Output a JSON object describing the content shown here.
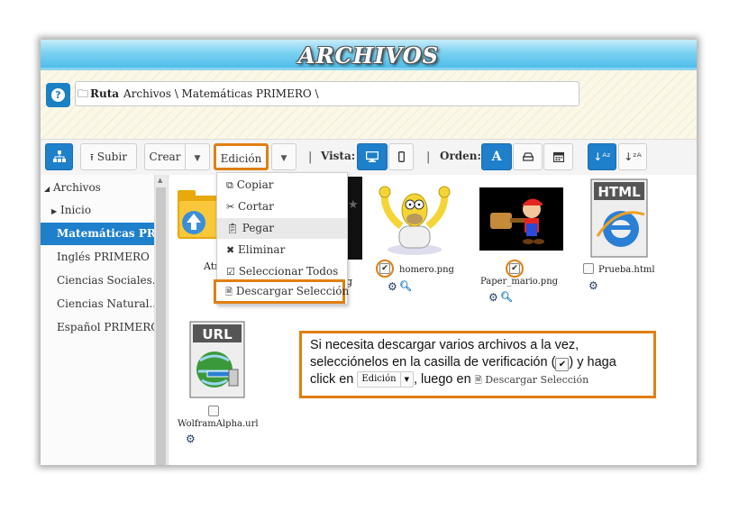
{
  "header": {
    "title": "ARCHIVOS"
  },
  "path_bar": {
    "route_label": "Ruta",
    "path_value": "Archivos \\ Matemáticas PRIMERO \\"
  },
  "toolbar": {
    "upload_label": "Subir",
    "create_label": "Crear",
    "edit_label": "Edición",
    "view_label": "Vista:",
    "order_label": "Orden:",
    "sort_a_label": "A",
    "separator": "|"
  },
  "sidebar": {
    "root": "Archivos",
    "items": [
      "Inicio",
      "Matemáticas PRI...",
      "Inglés PRIMERO",
      "Ciencias Sociales...",
      "Ciencias Natural...",
      "Español PRIMERO"
    ]
  },
  "edit_menu": {
    "items": [
      "Copiar",
      "Cortar",
      "Pegar",
      "Eliminar",
      "Seleccionar Todos",
      "Descargar Selección"
    ],
    "highlighted": "Pegar"
  },
  "files": [
    {
      "name": "Atr",
      "icon": "folder-icon"
    },
    {
      "name": "g",
      "icon": "image-thumbnail"
    },
    {
      "name": "homero.png",
      "icon": "image-thumbnail",
      "checked": true
    },
    {
      "name": "Paper_mario.png",
      "icon": "image-thumbnail",
      "checked": true
    },
    {
      "name": "Prueba.html",
      "icon": "html-file-icon",
      "checked": false
    },
    {
      "name": "WolframAlpha.url",
      "icon": "url-file-icon",
      "checked": false
    }
  ],
  "thumb_texts": {
    "html": "HTML",
    "url": "URL"
  },
  "note": {
    "line1": "Si necesita descargar varios archivos a la vez,",
    "line2_a": "selecciónelos en la casilla de verificación (",
    "line2_b": ") y haga",
    "line3_a": "click en",
    "line3_b": ", luego en",
    "edit_label": "Edición",
    "download_label": "Descargar Selección"
  },
  "colors": {
    "accent": "#1e7fcb",
    "highlight_border": "#e07f12",
    "header_blue": "#45b9e8"
  }
}
